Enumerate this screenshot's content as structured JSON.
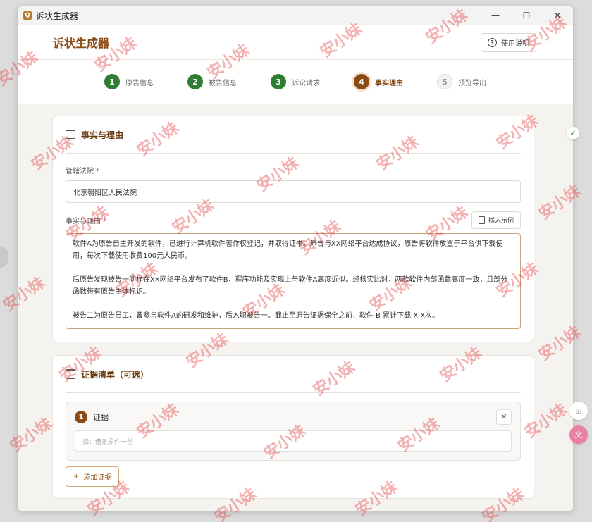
{
  "window": {
    "title": "诉状生成器",
    "controls": [
      "—",
      "☐",
      "✕"
    ]
  },
  "header": {
    "title": "诉状生成器",
    "help_label": "使用说明",
    "help_icon": "question-circle-icon"
  },
  "steps": [
    {
      "num": "1",
      "label": "原告信息",
      "state": "done"
    },
    {
      "num": "2",
      "label": "被告信息",
      "state": "done"
    },
    {
      "num": "3",
      "label": "诉讼请求",
      "state": "done"
    },
    {
      "num": "4",
      "label": "事实理由",
      "state": "active"
    },
    {
      "num": "5",
      "label": "预览导出",
      "state": "todo"
    }
  ],
  "facts": {
    "title": "事实与理由",
    "court_label": "管辖法院",
    "court_value": "北京朝阳区人民法院",
    "facts_label": "事实与理由",
    "insert_label": "插入示例",
    "paragraphs": [
      "软件A为原告自主开发的软件，已进行计算机软件著作权登记，并取得证书。原告与XX网络平台达成协议，原告将软件放置于平台供下载使用，每次下载使用收费100元人民币。",
      "后原告发现被告一同样在XX网络平台发布了软件B，程序功能及实现上与软件A高度近似。经核实比对，两款软件内部函数高度一致，且部分函数带有原告主体标识。",
      "被告二为原告员工，曾参与软件A的研发和维护，后入职被告一。截止至原告证据保全之前，软件 B 累计下载 X X次。"
    ]
  },
  "evidence": {
    "title": "证据清单（可选）",
    "item_num": "1",
    "item_label": "证据",
    "item_placeholder": "如：借条原件一份",
    "close": "✕",
    "add_label": "添加证据",
    "add_icon": "+"
  },
  "watermark": "安小妹",
  "colors": {
    "brand": "#8a4a12",
    "done": "#2e7d32",
    "watermark": "#e24646"
  }
}
